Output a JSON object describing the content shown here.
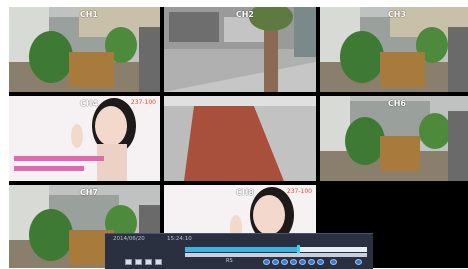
{
  "tiles": [
    {
      "id": "r1c1",
      "label": "CH1",
      "label_red": false,
      "scene": "garden"
    },
    {
      "id": "r1c2",
      "label": "CH2",
      "label_red": false,
      "scene": "street"
    },
    {
      "id": "r1c3",
      "label": "CH3",
      "label_red": false,
      "scene": "garden"
    },
    {
      "id": "r2c1",
      "label": "CH4",
      "label_red": false,
      "number": "237-100",
      "scene": "portrait"
    },
    {
      "id": "r2c2",
      "label": "",
      "label_red": false,
      "scene": "walkway"
    },
    {
      "id": "r2c3",
      "label": "CH6",
      "label_red": false,
      "scene": "garden"
    },
    {
      "id": "r3c1",
      "label": "CH7",
      "label_red": false,
      "scene": "garden"
    },
    {
      "id": "r3c2",
      "label": "CH8",
      "label_red": false,
      "number": "237-100",
      "scene": "portrait"
    }
  ],
  "playback": {
    "date": "2014/06/20",
    "time": "15:24:10",
    "rs_label": "RS",
    "progress": 0.62,
    "controls": [
      "rewind",
      "slow",
      "prev-frame",
      "pause",
      "play",
      "next-frame",
      "fast",
      "stop",
      "full"
    ]
  },
  "colors": {
    "panel": "#2a3040",
    "accent": "#3ab4e0",
    "ch_label": "#ffffff",
    "number": "#e04a3a"
  }
}
